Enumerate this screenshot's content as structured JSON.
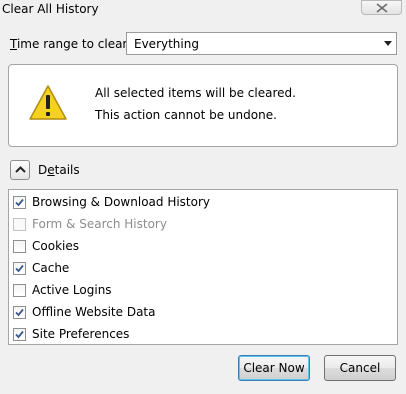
{
  "window": {
    "title": "Clear All History"
  },
  "range": {
    "label_prefix": "",
    "label_accesskey": "T",
    "label_rest": "ime range to clear:",
    "selected": "Everything"
  },
  "warning": {
    "line1": "All selected items will be cleared.",
    "line2": "This action cannot be undone."
  },
  "details": {
    "label_prefix": "D",
    "label_accesskey": "e",
    "label_rest": "tails",
    "expanded": true
  },
  "items": [
    {
      "label": "Browsing & Download History",
      "checked": true,
      "disabled": false
    },
    {
      "label": "Form & Search History",
      "checked": false,
      "disabled": true
    },
    {
      "label": "Cookies",
      "checked": false,
      "disabled": false
    },
    {
      "label": "Cache",
      "checked": true,
      "disabled": false
    },
    {
      "label": "Active Logins",
      "checked": false,
      "disabled": false
    },
    {
      "label": "Offline Website Data",
      "checked": true,
      "disabled": false
    },
    {
      "label": "Site Preferences",
      "checked": true,
      "disabled": false
    }
  ],
  "buttons": {
    "clear": "Clear Now",
    "cancel": "Cancel"
  },
  "colors": {
    "window_bg": "#f0f0f0",
    "warning_yellow": "#f5d21f",
    "check_blue": "#3a5a8c"
  }
}
